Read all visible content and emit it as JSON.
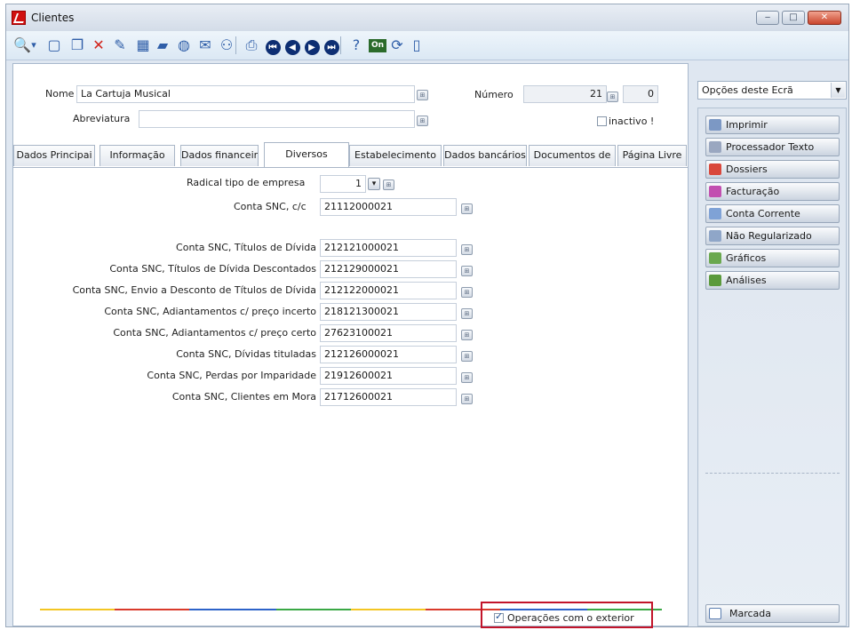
{
  "window": {
    "title": "Clientes",
    "minimize": "‒",
    "maximize": "□",
    "close": "✕"
  },
  "toolbar": [
    {
      "name": "search-icon",
      "glyph": "🔍"
    },
    {
      "name": "dropdown-arrow-icon",
      "glyph": "▾"
    },
    {
      "name": "new-document-icon",
      "glyph": "▢"
    },
    {
      "name": "copy-document-icon",
      "glyph": "❐"
    },
    {
      "name": "delete-icon",
      "glyph": "✕"
    },
    {
      "name": "edit-icon",
      "glyph": "✎"
    },
    {
      "name": "grid-icon",
      "glyph": "▦"
    },
    {
      "name": "folder-icon",
      "glyph": "▰"
    },
    {
      "name": "database-icon",
      "glyph": "◍"
    },
    {
      "name": "mail-icon",
      "glyph": "✉"
    },
    {
      "name": "binoculars-icon",
      "glyph": "⚇"
    },
    {
      "name": "print-preview-icon",
      "glyph": "⎙"
    },
    {
      "name": "first-record-icon",
      "glyph": "⏮"
    },
    {
      "name": "previous-record-icon",
      "glyph": "◀"
    },
    {
      "name": "next-record-icon",
      "glyph": "▶"
    },
    {
      "name": "last-record-icon",
      "glyph": "⏭"
    },
    {
      "name": "help-icon",
      "glyph": "?"
    },
    {
      "name": "on-icon",
      "glyph": "On"
    },
    {
      "name": "refresh-icon",
      "glyph": "⟳"
    },
    {
      "name": "page-icon",
      "glyph": "▯"
    }
  ],
  "form": {
    "nome_label": "Nome",
    "nome_value": "La Cartuja Musical",
    "numero_label": "Número",
    "numero_value": "21",
    "numero_extra": "0",
    "abreviatura_label": "Abreviatura",
    "abreviatura_value": "",
    "inactivo_label": "inactivo !",
    "inactivo_checked": false
  },
  "tabs": [
    {
      "label": "Dados Principai",
      "active": false
    },
    {
      "label": "Informação",
      "active": false
    },
    {
      "label": "Dados financeir",
      "active": false
    },
    {
      "label": "Diversos",
      "active": true
    },
    {
      "label": "Estabelecimento",
      "active": false
    },
    {
      "label": "Dados bancários",
      "active": false
    },
    {
      "label": "Documentos de",
      "active": false
    },
    {
      "label": "Página Livre",
      "active": false
    }
  ],
  "diversos": {
    "radical_label": "Radical tipo de empresa",
    "radical_value": "1",
    "conta_cc_label": "Conta SNC, c/c",
    "conta_cc_value": "21112000021",
    "rows": [
      {
        "label": "Conta SNC, Títulos de Dívida",
        "value": "212121000021"
      },
      {
        "label": "Conta SNC, Títulos de Dívida Descontados",
        "value": "212129000021"
      },
      {
        "label": "Conta SNC, Envio a Desconto de Títulos de Dívida",
        "value": "212122000021"
      },
      {
        "label": "Conta SNC, Adiantamentos c/ preço incerto",
        "value": "218121300021"
      },
      {
        "label": "Conta SNC, Adiantamentos c/ preço certo",
        "value": "27623100021"
      },
      {
        "label": "Conta SNC, Dívidas tituladas",
        "value": "212126000021"
      },
      {
        "label": "Conta SNC, Perdas por Imparidade",
        "value": "21912600021"
      },
      {
        "label": "Conta SNC, Clientes em Mora",
        "value": "21712600021"
      }
    ],
    "operacoes_label": "Operações com o exterior",
    "operacoes_checked": true
  },
  "side": {
    "combo_value": "Opções deste Ecrã",
    "buttons": [
      {
        "label": "Imprimir",
        "icon": "printer-icon",
        "color": "#7c98c4"
      },
      {
        "label": "Processador Texto",
        "icon": "pen-icon",
        "color": "#9aa7c0"
      },
      {
        "label": "Dossiers",
        "icon": "dossier-icon",
        "color": "#d9473b"
      },
      {
        "label": "Facturação",
        "icon": "invoice-icon",
        "color": "#c24fb0"
      },
      {
        "label": "Conta Corrente",
        "icon": "account-icon",
        "color": "#7fa2d6"
      },
      {
        "label": "Não Regularizado",
        "icon": "unsettled-icon",
        "color": "#8fa6c8"
      },
      {
        "label": "Gráficos",
        "icon": "chart-icon",
        "color": "#6aa84f"
      },
      {
        "label": "Análises",
        "icon": "analysis-icon",
        "color": "#5b9a3c"
      }
    ],
    "marcada_label": "Marcada"
  }
}
